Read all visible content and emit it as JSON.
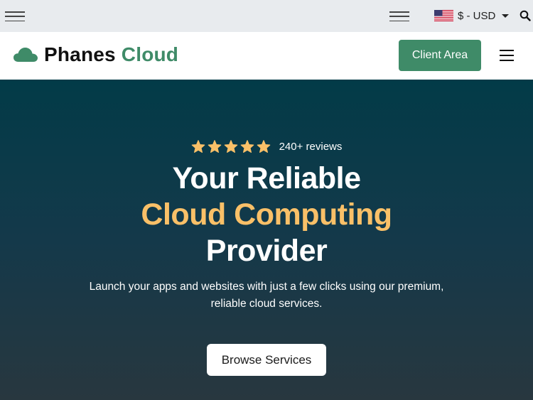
{
  "topbar": {
    "currency_label": "$ - USD"
  },
  "header": {
    "brand_word1": "Phanes",
    "brand_word2": "Cloud",
    "client_button": "Client Area"
  },
  "hero": {
    "rating": 5,
    "reviews": "240+ reviews",
    "headline_line1": "Your Reliable",
    "headline_line2": "Cloud Computing",
    "headline_line3": "Provider",
    "subtext": "Launch your apps and websites with just a few clicks using our premium, reliable cloud services.",
    "cta_button": "Browse Services"
  },
  "colors": {
    "brand_green": "#3f8b68",
    "accent_orange": "#f9c068",
    "hero_top": "#023b48",
    "hero_bottom": "#28373f",
    "star": "#f9c068"
  },
  "icons": [
    "menu-icon",
    "us-flag-icon",
    "caret-down-icon",
    "search-icon",
    "cloud-logo-icon",
    "star-icon"
  ]
}
